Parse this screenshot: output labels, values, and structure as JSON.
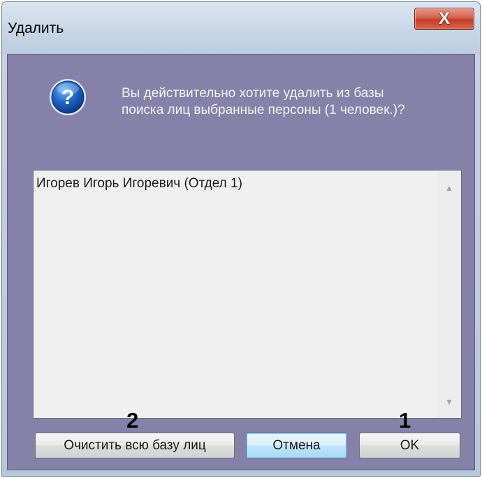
{
  "window": {
    "title": "Удалить",
    "close_symbol": "X"
  },
  "dialog": {
    "icon": "question-icon",
    "message_line1": "Вы действительно хотите удалить из базы",
    "message_line2": "поиска лиц выбранные персоны (1 человек.)?"
  },
  "list": {
    "items": [
      "Игорев Игорь Игоревич (Отдел 1)"
    ],
    "scroll_up_symbol": "▲",
    "scroll_down_symbol": "▼"
  },
  "markers": {
    "clear_marker": "2",
    "ok_marker": "1"
  },
  "buttons": {
    "clear_all": "Очистить всю базу лиц",
    "cancel": "Отмена",
    "ok": "OK"
  },
  "colors": {
    "content_background": "#8681a8",
    "close_button": "#c43c27",
    "default_button_border": "#3c7fb1"
  }
}
